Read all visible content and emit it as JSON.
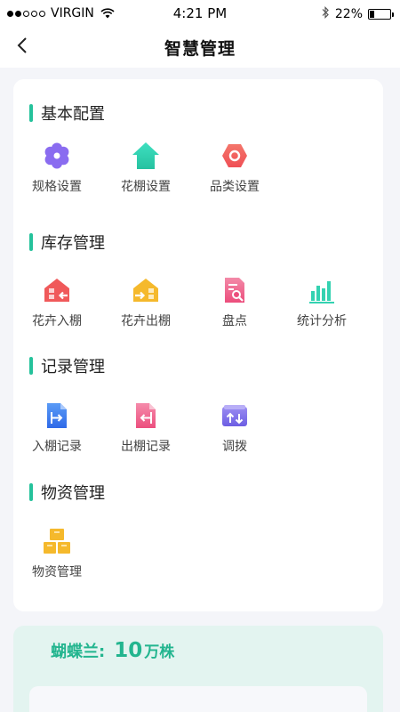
{
  "status_bar": {
    "carrier": "VIRGIN",
    "time": "4:21 PM",
    "battery": "22%",
    "battery_level": 0.22
  },
  "nav": {
    "title": "智慧管理",
    "back_icon": "chevron-left-icon"
  },
  "sections": {
    "basic": {
      "title": "基本配置",
      "items": [
        {
          "label": "规格设置",
          "icon": "settings-flower-icon",
          "color": "#8a6cf0"
        },
        {
          "label": "花棚设置",
          "icon": "greenhouse-icon",
          "color": "#2fd6b5"
        },
        {
          "label": "品类设置",
          "icon": "category-hexagon-icon",
          "color": "#f0595a"
        }
      ]
    },
    "inventory": {
      "title": "库存管理",
      "items": [
        {
          "label": "花卉入棚",
          "icon": "flower-in-icon",
          "color": "#f0595a"
        },
        {
          "label": "花卉出棚",
          "icon": "flower-out-icon",
          "color": "#f5b92c"
        },
        {
          "label": "盘点",
          "icon": "stocktake-icon",
          "color": "#ef5c8b"
        },
        {
          "label": "统计分析",
          "icon": "bar-chart-icon",
          "color": "#34d2b1"
        }
      ]
    },
    "records": {
      "title": "记录管理",
      "items": [
        {
          "label": "入棚记录",
          "icon": "in-record-icon",
          "color": "#3d7cf0"
        },
        {
          "label": "出棚记录",
          "icon": "out-record-icon",
          "color": "#f0638f"
        },
        {
          "label": "调拨",
          "icon": "transfer-icon",
          "color": "#7a6de8"
        }
      ]
    },
    "materials": {
      "title": "物资管理",
      "items": [
        {
          "label": "物资管理",
          "icon": "boxes-icon",
          "color": "#f5b92c"
        }
      ]
    }
  },
  "stats": {
    "name": "蝴蝶兰:",
    "value": "10",
    "unit": "万株"
  }
}
